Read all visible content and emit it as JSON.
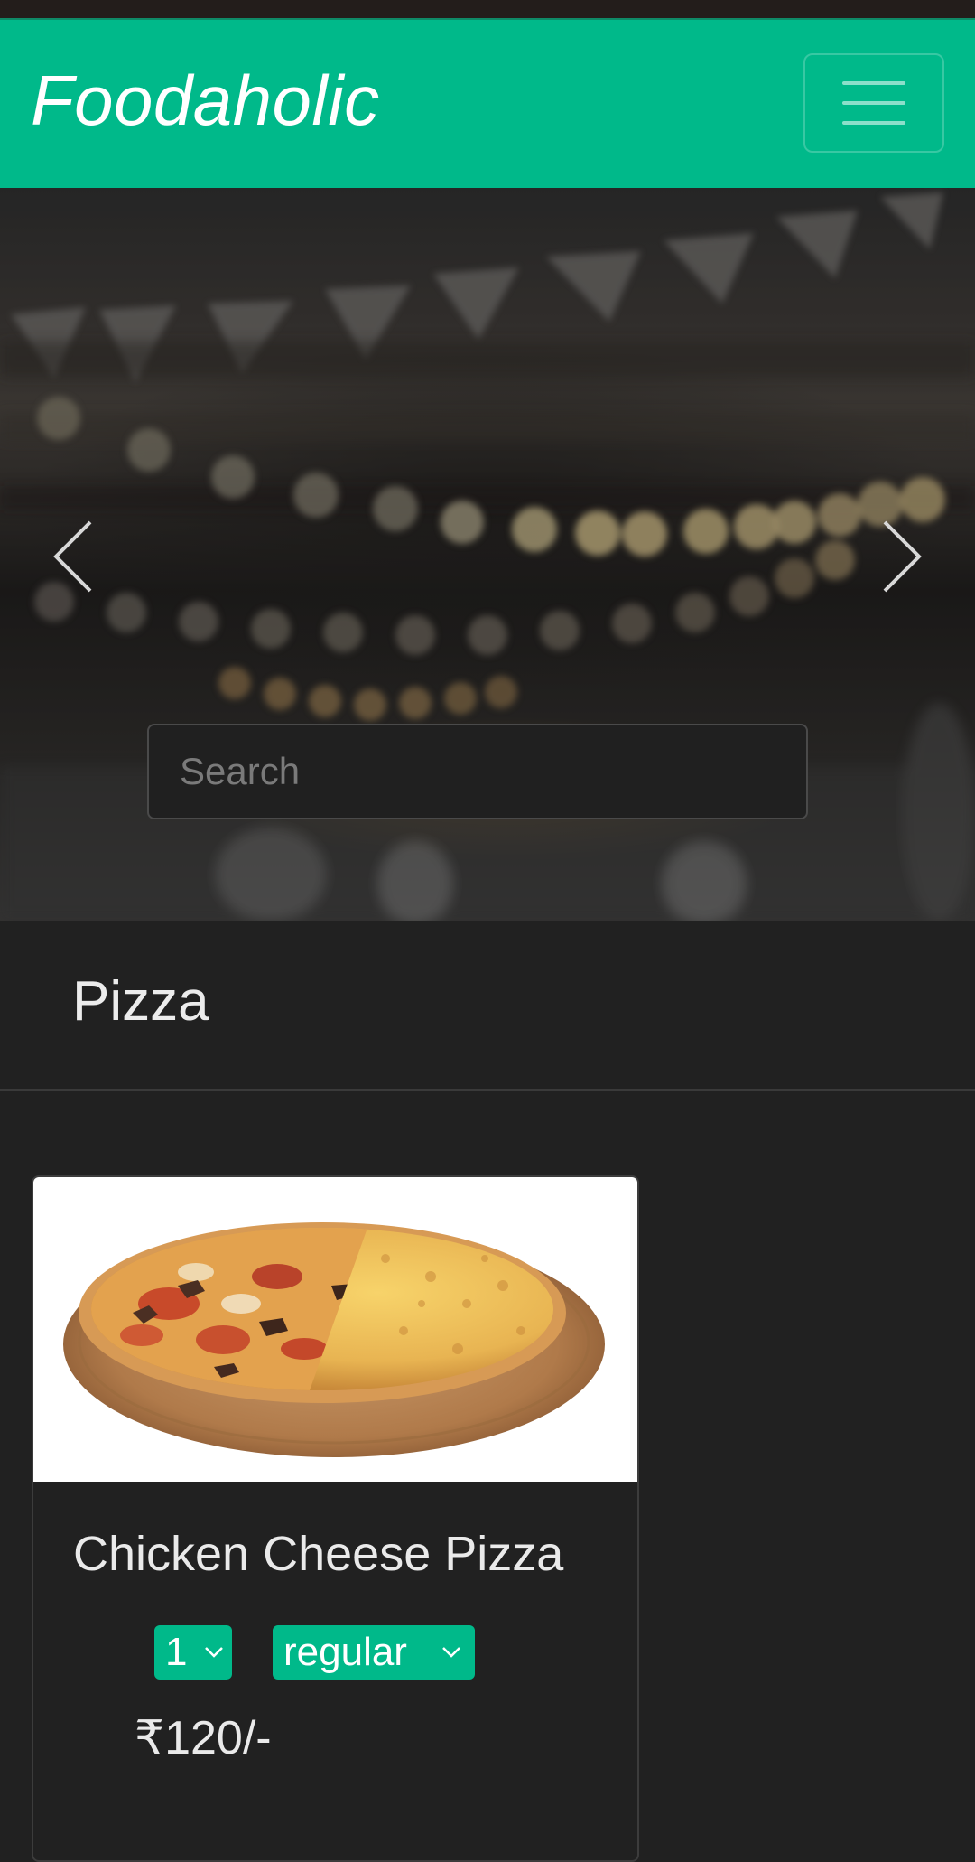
{
  "navbar": {
    "brand": "Foodaholic",
    "toggler_icon": "hamburger-menu-icon",
    "accent_color": "#00b98a"
  },
  "carousel": {
    "prev_icon": "chevron-left-icon",
    "next_icon": "chevron-right-icon"
  },
  "search": {
    "placeholder": "Search",
    "value": ""
  },
  "category": {
    "title": "Pizza"
  },
  "items": [
    {
      "name": "Chicken Cheese Pizza",
      "quantity": "1",
      "size": "regular",
      "price": "₹120/-"
    }
  ]
}
